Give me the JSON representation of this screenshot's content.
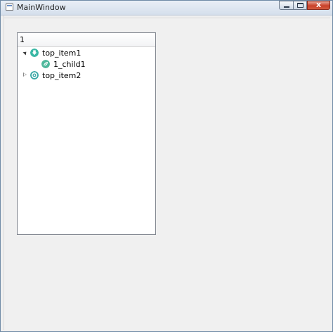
{
  "window": {
    "title": "MainWindow"
  },
  "titlebar": {
    "buttons": [
      {
        "name": "minimize",
        "icon": "minimize-icon"
      },
      {
        "name": "maximize",
        "icon": "maximize-icon"
      },
      {
        "name": "close",
        "icon": "close-icon",
        "glyph": "x"
      }
    ]
  },
  "tree": {
    "header": "1",
    "items": [
      {
        "label": "top_item1",
        "expanded": true,
        "icon": "download-circle-icon",
        "icon_color": "#38b7a4",
        "children": [
          {
            "label": "1_child1",
            "icon": "leaf-circle-icon",
            "icon_color": "#4fb89c"
          }
        ]
      },
      {
        "label": "top_item2",
        "expanded": false,
        "icon": "gear-circle-icon",
        "icon_color": "#3aa8a6",
        "children": []
      }
    ]
  },
  "colors": {
    "window_bg": "#f0f0f0",
    "close_button": "#c9412a",
    "tree_border": "#828790"
  }
}
